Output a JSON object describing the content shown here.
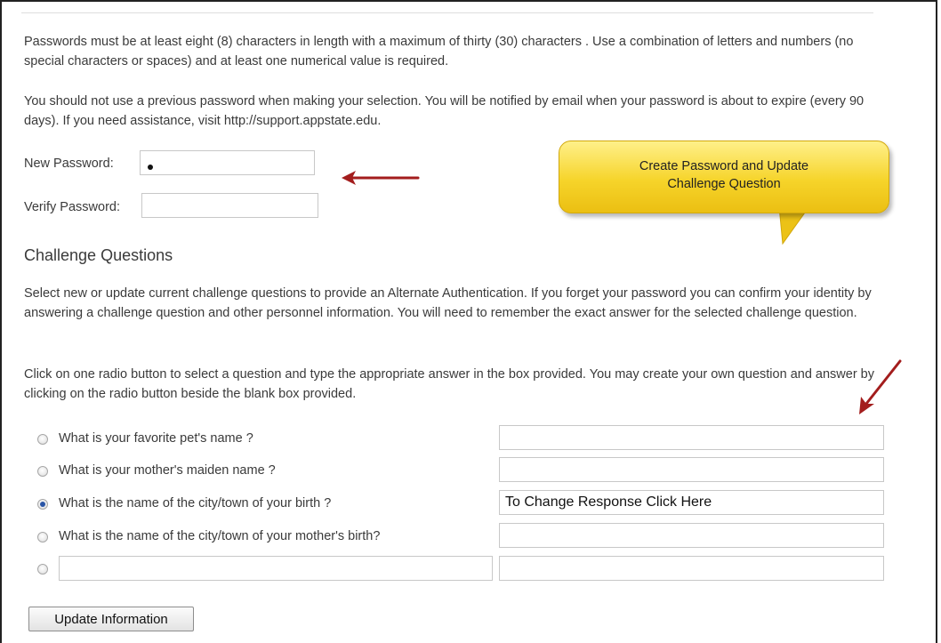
{
  "intro": {
    "para1": "Passwords must be at least eight (8) characters in length with a maximum of thirty (30) characters . Use a combination of letters and numbers (no special characters or spaces) and at least one numerical value is required.",
    "para2": "You should not use a previous password when making your selection. You will be notified by email when your password is about to expire (every 90 days). If you need assistance, visit http://support.appstate.edu."
  },
  "password": {
    "new_label": "New Password:",
    "verify_label": "Verify Password:"
  },
  "callout": {
    "line1": "Create Password and Update",
    "line2": "Challenge Question"
  },
  "challenge": {
    "title": "Challenge Questions",
    "para1": "Select new or update current challenge questions to provide an Alternate Authentication. If you forget your password you can confirm your identity by answering a challenge question and other personnel information. You will need to remember the exact answer for the selected challenge question.",
    "para2": "Click on one radio button to select a question and type the appropriate answer in the box provided. You may create your own question and answer by clicking on the radio button beside the blank box provided.",
    "questions": [
      {
        "text": "What is your favorite pet's name ?",
        "selected": false,
        "answer": ""
      },
      {
        "text": "What is your mother's maiden name ?",
        "selected": false,
        "answer": ""
      },
      {
        "text": "What is the name of the city/town of your birth ?",
        "selected": true,
        "answer": "To Change Response Click Here"
      },
      {
        "text": "What is the name of the city/town of your mother's birth?",
        "selected": false,
        "answer": ""
      }
    ],
    "custom_question": {
      "text": "",
      "answer": ""
    }
  },
  "actions": {
    "update_label": "Update Information"
  },
  "colors": {
    "arrow": "#a31d1d",
    "callout": "#f6d42a",
    "radio_selected": "#2a55a6"
  }
}
